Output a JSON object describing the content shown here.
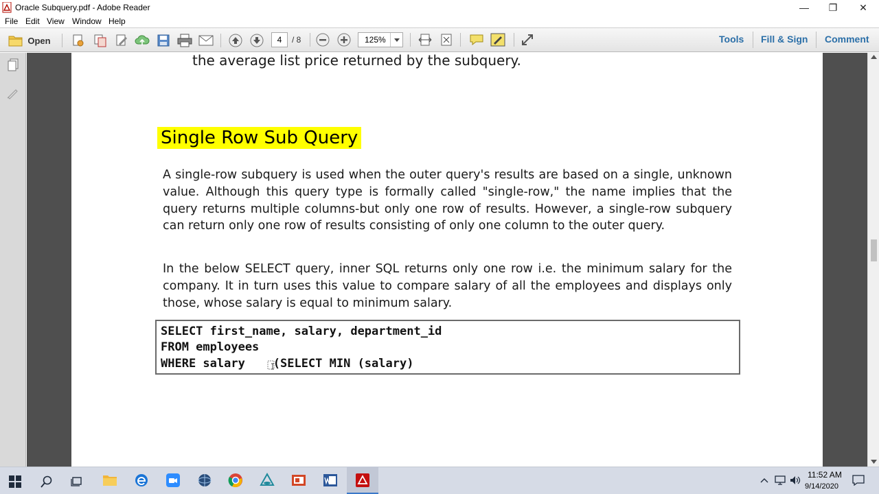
{
  "window": {
    "title": "Oracle Subquery.pdf - Adobe Reader",
    "minimize": "—",
    "restore": "❐",
    "close": "✕"
  },
  "menu": [
    "File",
    "Edit",
    "View",
    "Window",
    "Help"
  ],
  "toolbar": {
    "open_label": "Open",
    "page_current": "4",
    "page_total": "/ 8",
    "zoom": "125%",
    "tools_label": "Tools",
    "fill_sign_label": "Fill & Sign",
    "comment_label": "Comment"
  },
  "document": {
    "prev_line": "the average list price returned by the subquery.",
    "heading": "Single Row Sub Query",
    "paragraph1": "A single-row subquery is used when the outer query's results are based on a single, unknown value. Although this query type is formally called \"single-row,\" the name implies that the query returns multiple columns-but only one row of results. However, a single-row subquery can return only one row of results consisting of only one column to the outer query.",
    "paragraph2": "In the below SELECT query, inner SQL returns only one row i.e. the minimum salary for the company. It in turn uses this value to compare salary of all the employees and displays only those, whose salary is equal to minimum salary.",
    "code": [
      "SELECT first_name, salary, department_id",
      "FROM employees",
      "WHERE salary    (SELECT MIN (salary)"
    ]
  },
  "taskbar": {
    "time": "11:52 AM",
    "date": "9/14/2020"
  },
  "colors": {
    "highlight": "#ffff00",
    "doc_bg": "#4f4f4f",
    "accent": "#2b6fa8"
  }
}
